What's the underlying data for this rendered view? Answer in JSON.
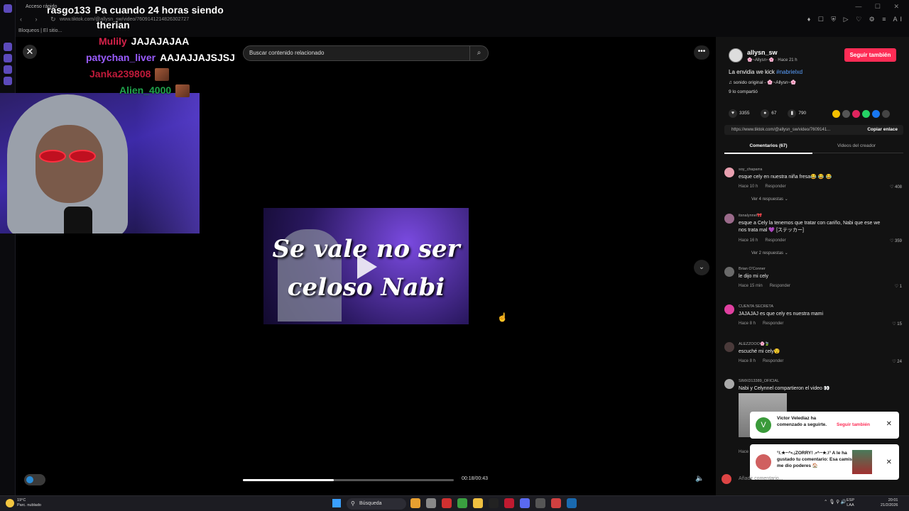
{
  "browser": {
    "tab_title": "Acceso rápido",
    "url": "www.tiktok.com/@allysn_sw/video/7609141214826302727",
    "bookmark": "Bloqueos | El sitio...",
    "nav_arrows": "‹ › ↻",
    "extension_icons": "♦ ☐ ⛨ ▷ ♡ ⚙ ≡ AI",
    "window_controls": "— ☐ ✕"
  },
  "stream_chat": [
    {
      "user": "rasgo133",
      "message": "Pa cuando 24 horas siendo",
      "color": "#e6e6e6"
    },
    {
      "user": "",
      "message": "therian",
      "color": "#e6e6e6"
    },
    {
      "user": "Mulily",
      "message": "JAJAJAJAA",
      "color": "#d6224a"
    },
    {
      "user": "patychan_liver",
      "message": "AAJAJJAJSJSJ",
      "color": "#9a5cff"
    },
    {
      "user": "Janka239808",
      "message": "",
      "color": "#c01a3a"
    },
    {
      "user": "Alien_4000",
      "message": "",
      "color": "#1fa24a"
    }
  ],
  "player": {
    "search_placeholder": "Buscar contenido relacionado",
    "close_glyph": "✕",
    "search_glyph": "⌕",
    "more_glyph": "•••",
    "down_glyph": "⌄",
    "volume_glyph": "🔈",
    "caption_line1": "Se vale no ser",
    "caption_line2": "celoso Nabi",
    "time": "00:18/00:43",
    "progress": 0.43
  },
  "post": {
    "author": "allysn_sw",
    "author_sub": "🌸~Allysn~🌸 · Hace 21 h",
    "follow_label": "Seguir también",
    "description": "La envidia we kick ",
    "hashtag": "#nabrielxd",
    "sound": "♫  sonido original - 🌸~Allysn~🌸",
    "shared": "9 lo compartió",
    "likes": "3355",
    "comments": "67",
    "saves": "790",
    "link": "https://www.tiktok.com/@allysn_sw/video/7609141...",
    "copy_label": "Copiar enlace",
    "tab_comments": "Comentarios (67)",
    "tab_videos": "Videos del creador"
  },
  "comments": [
    {
      "user": "soy_chaparra",
      "text": "esque cely en nuestra niña fresa😂 😂 😂",
      "time": "Hace 10 h",
      "reply": "Responder",
      "likes": "♡ 408",
      "replies": "Ver 4 respuestas ⌄",
      "color": "#e8a0b0"
    },
    {
      "user": "itsnalynnel🎀",
      "text": "esque a Cely la tenemos que tratar con cariño, Nabi que ese we nos trata mal 💜 [ステッカー]",
      "time": "Hace 16 h",
      "reply": "Responder",
      "likes": "♡ 359",
      "replies": "Ver 2 respuestas ⌄",
      "color": "#9a6a8a"
    },
    {
      "user": "Brian O'Conner",
      "text": "le dijo mi cely",
      "time": "Hace 15 min",
      "reply": "Responder",
      "likes": "♡ 1",
      "replies": "",
      "color": "#6a6a6a"
    },
    {
      "user": "CUENTA SECRETA",
      "text": "JAJAJAJ es que cely es nuestra mami",
      "time": "Hace 8 h",
      "reply": "Responder",
      "likes": "♡ 15",
      "replies": "",
      "color": "#e040a0"
    },
    {
      "user": "ALEZZOOO🌸🍃",
      "text": "escuché mi cely😯",
      "time": "Hace 8 h",
      "reply": "Responder",
      "likes": "♡ 24",
      "replies": "",
      "color": "#4a3a3a"
    },
    {
      "user": "SIMXD13389_OFICIAL",
      "text": "Nabi y Celynnel compartieron el video 👀",
      "time": "Hace",
      "reply": "",
      "likes": "",
      "replies": "",
      "color": "#aaa"
    }
  ],
  "notifications": [
    {
      "initial": "V",
      "text": "Victor Velediaz ha comenzado a seguirte.",
      "action": "Seguir también",
      "color": "#3a9a3a"
    },
    {
      "text": "°/.★~^•.¡ZORRY! .•^~★.\\° A le ha gustado tu comentario: Esa camiseta me dio poderes 🏠",
      "color": "#d06060"
    }
  ],
  "comment_input_placeholder": "Añadir comentario...",
  "taskbar": {
    "weather_temp": "19°C",
    "weather_desc": "Parc. nublado",
    "search_label": "Búsqueda",
    "lang_top": "ESP",
    "lang_bottom": "LAA",
    "time": "20:01",
    "date": "21/2/2026",
    "tray": "⌃ 🎙 ⚲ 🔊"
  },
  "colors": {
    "accent": "#fe2c55",
    "hashtag": "#5aa0ff",
    "panel": "#121212"
  }
}
